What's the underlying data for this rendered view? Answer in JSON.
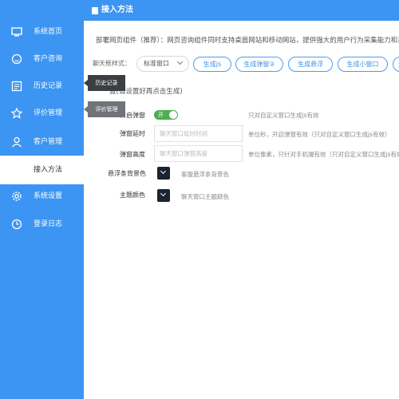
{
  "sidebar": {
    "items": [
      {
        "label": "系统首页",
        "icon": "monitor-icon"
      },
      {
        "label": "客户咨询",
        "icon": "chat-icon"
      },
      {
        "label": "历史记录",
        "icon": "history-icon"
      },
      {
        "label": "评价管理",
        "icon": "star-icon"
      },
      {
        "label": "客户管理",
        "icon": "user-icon"
      },
      {
        "label": "接入方法",
        "icon": "",
        "active": true
      },
      {
        "label": "系统设置",
        "icon": "gear-icon"
      },
      {
        "label": "登录日志",
        "icon": "clock-icon"
      }
    ]
  },
  "header": {
    "title": "接入方法",
    "icon": "document-icon"
  },
  "description": "部署网页组件（推荐）：网页咨询组件同时支持桌面网站和移动网站，提供强大的用户行为采集能力和系",
  "chat_style": {
    "label": "聊天框样式：",
    "selected": "标准窗口",
    "buttons": [
      "生成js",
      "生成弹窗②",
      "生成悬浮",
      "生成小窗口",
      "生成"
    ]
  },
  "section_label": "置(请设置好再点击生成)",
  "settings": {
    "popup": {
      "label": "开启弹窗",
      "toggle_text": "开",
      "hint": "只对自定义窗口生成js有效"
    },
    "delay": {
      "label": "弹窗延时",
      "placeholder": "聊天窗口延时时间",
      "hint": "单位秒，开启弹窗有效（只对自定义窗口生成js有效）"
    },
    "height": {
      "label": "弹窗高度",
      "placeholder": "聊天窗口弹窗高度",
      "hint": "单位像素，只针对手机端有效（只对自定义窗口生成js有效）"
    },
    "float_bg": {
      "label": "悬浮条背景色",
      "hint": "客服悬浮条背景色"
    },
    "theme": {
      "label": "主题颜色",
      "hint": "聊天窗口主题颜色"
    }
  },
  "tooltips": {
    "history": "历史记录",
    "rating": "评价管理"
  },
  "colors": {
    "accent": "#3c95f2",
    "toggle_on": "#4caf50",
    "swatch": "#1b2430"
  }
}
